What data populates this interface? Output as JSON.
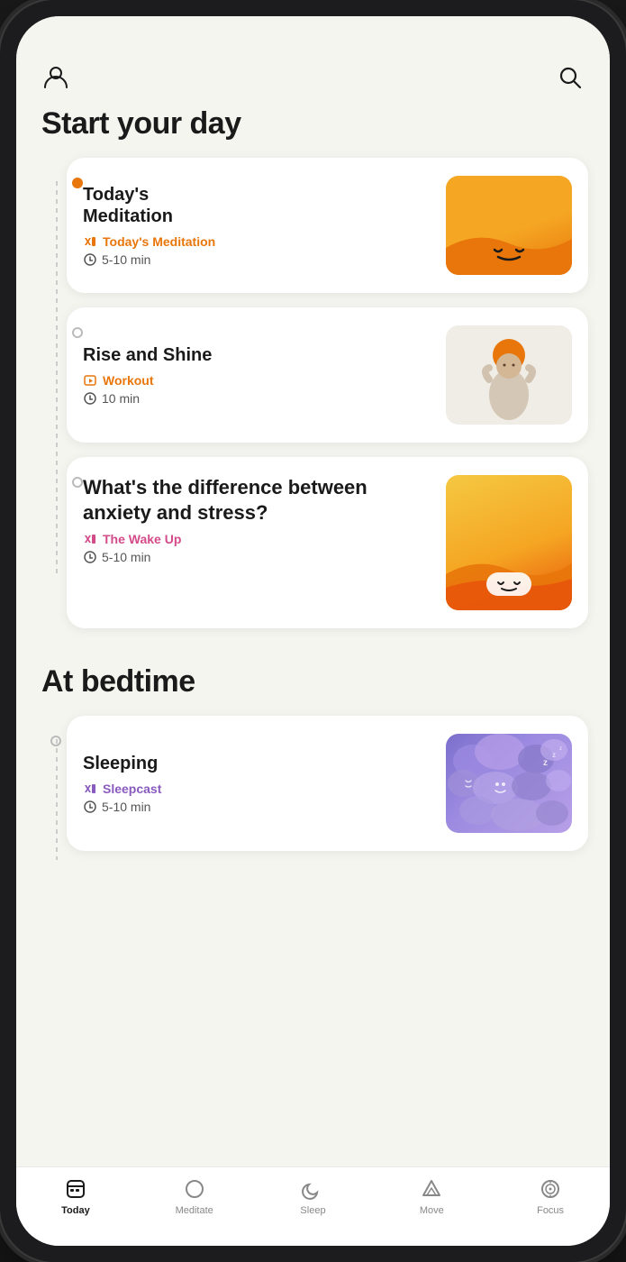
{
  "app": {
    "title": "Start your day",
    "section2_title": "At bedtime"
  },
  "header": {
    "profile_icon": "person",
    "search_icon": "search"
  },
  "cards": [
    {
      "id": "meditation",
      "title": "Today's\nMeditation",
      "subtitle_label": "Today's Meditation",
      "subtitle_color": "orange",
      "duration": "5-10 min",
      "image_type": "meditation",
      "timeline_active": true
    },
    {
      "id": "rise-shine",
      "title": "Rise and Shine",
      "subtitle_label": "Workout",
      "subtitle_color": "orange",
      "duration": "10 min",
      "image_type": "rise",
      "timeline_active": false
    },
    {
      "id": "anxiety",
      "title": "What's the difference between anxiety and stress?",
      "subtitle_label": "The Wake Up",
      "subtitle_color": "pink",
      "duration": "5-10 min",
      "image_type": "anxiety",
      "timeline_active": false
    }
  ],
  "bedtime_cards": [
    {
      "id": "sleeping",
      "title": "Sleeping",
      "subtitle_label": "Sleepcast",
      "subtitle_color": "purple",
      "duration": "5-10 min",
      "image_type": "sleeping"
    }
  ],
  "nav": {
    "items": [
      {
        "id": "today",
        "label": "Today",
        "icon": "today",
        "active": true
      },
      {
        "id": "meditate",
        "label": "Meditate",
        "icon": "circle",
        "active": false
      },
      {
        "id": "sleep",
        "label": "Sleep",
        "icon": "moon",
        "active": false
      },
      {
        "id": "move",
        "label": "Move",
        "icon": "move",
        "active": false
      },
      {
        "id": "focus",
        "label": "Focus",
        "icon": "focus",
        "active": false
      }
    ]
  }
}
